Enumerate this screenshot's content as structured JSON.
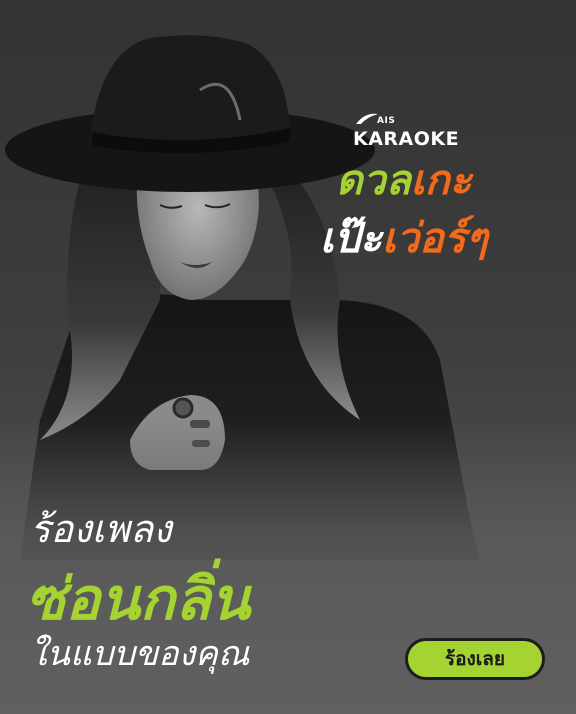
{
  "brand": {
    "logo_small": "AIS",
    "logo_name": "KARAOKE"
  },
  "headline": {
    "line1_part1": "ดวล",
    "line1_part2": "เกะ",
    "line2_part1": "เป๊ะ",
    "line2_part2": "เว่อร์ๆ"
  },
  "tagline": {
    "line1": "ร้องเพลง",
    "line2": "ซ่อนกลิ่น",
    "line3": "ในแบบของคุณ"
  },
  "cta": {
    "label": "ร้องเลย"
  },
  "colors": {
    "accent_green": "#a4d332",
    "accent_orange": "#f26a1b",
    "background": "#3a3a3a"
  }
}
